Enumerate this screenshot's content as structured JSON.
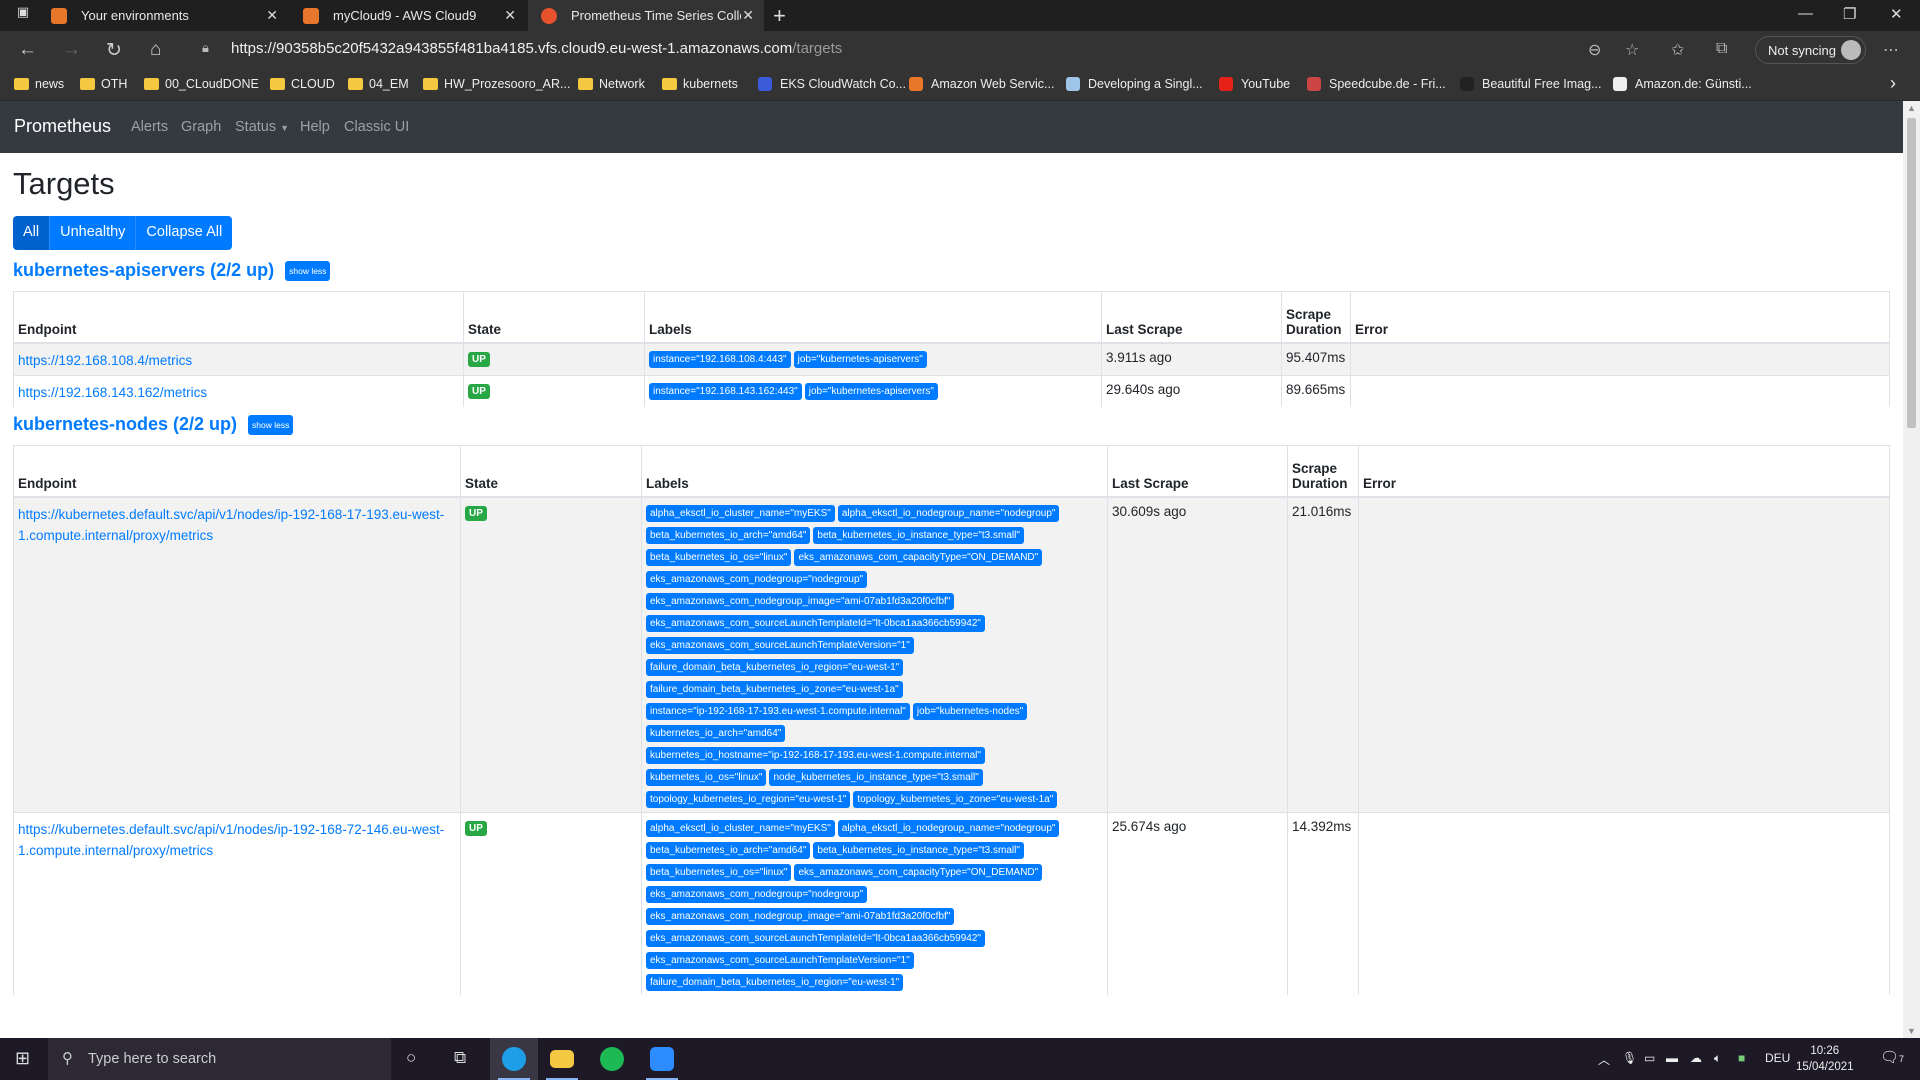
{
  "browser": {
    "tabs": [
      {
        "title": "Your environments",
        "color": "#e8762b"
      },
      {
        "title": "myCloud9 - AWS Cloud9",
        "color": "#e8762b"
      },
      {
        "title": "Prometheus Time Series Collecti",
        "color": "#e6522c"
      }
    ],
    "url_base": "https://90358b5c20f5432a943855f481ba4185.vfs.cloud9.eu-west-1.amazonaws.com",
    "url_path": "/targets",
    "sync_label": "Not syncing",
    "bookmarks": [
      {
        "label": "news",
        "kind": "folder"
      },
      {
        "label": "OTH",
        "kind": "folder"
      },
      {
        "label": "00_CLoudDONE",
        "kind": "folder"
      },
      {
        "label": "CLOUD",
        "kind": "folder"
      },
      {
        "label": "04_EM",
        "kind": "folder"
      },
      {
        "label": "HW_Prozesooro_AR...",
        "kind": "folder"
      },
      {
        "label": "Network",
        "kind": "folder"
      },
      {
        "label": "kubernets",
        "kind": "folder"
      },
      {
        "label": "EKS CloudWatch Co...",
        "kind": "site",
        "color": "#3b5bdb"
      },
      {
        "label": "Amazon Web Servic...",
        "kind": "site",
        "color": "#e8762b"
      },
      {
        "label": "Developing a Singl...",
        "kind": "site",
        "color": "#9ec5e8"
      },
      {
        "label": "YouTube",
        "kind": "site",
        "color": "#e62117"
      },
      {
        "label": "Speedcube.de - Fri...",
        "kind": "site",
        "color": "#c44"
      },
      {
        "label": "Beautiful Free Imag...",
        "kind": "site",
        "color": "#222"
      },
      {
        "label": "Amazon.de: Günsti...",
        "kind": "site",
        "color": "#eee"
      }
    ]
  },
  "nav": {
    "brand": "Prometheus",
    "links": [
      "Alerts",
      "Graph",
      "Status",
      "Help",
      "Classic UI"
    ]
  },
  "page": {
    "title": "Targets",
    "filters": [
      "All",
      "Unhealthy",
      "Collapse All"
    ],
    "show_less": "show less",
    "columns": [
      "Endpoint",
      "State",
      "Labels",
      "Last Scrape",
      "Scrape Duration",
      "Error"
    ]
  },
  "pools": [
    {
      "name": "kubernetes-apiservers (2/2 up)",
      "targets": [
        {
          "endpoint": "https://192.168.108.4/metrics",
          "state": "UP",
          "labels": [
            "instance=\"192.168.108.4:443\"",
            "job=\"kubernetes-apiservers\""
          ],
          "last_scrape": "3.911s ago",
          "duration": "95.407ms",
          "error": ""
        },
        {
          "endpoint": "https://192.168.143.162/metrics",
          "state": "UP",
          "labels": [
            "instance=\"192.168.143.162:443\"",
            "job=\"kubernetes-apiservers\""
          ],
          "last_scrape": "29.640s ago",
          "duration": "89.665ms",
          "error": ""
        }
      ]
    },
    {
      "name": "kubernetes-nodes (2/2 up)",
      "targets": [
        {
          "endpoint": "https://kubernetes.default.svc/api/v1/nodes/ip-192-168-17-193.eu-west-1.compute.internal/proxy/metrics",
          "state": "UP",
          "labels": [
            "alpha_eksctl_io_cluster_name=\"myEKS\"",
            "alpha_eksctl_io_nodegroup_name=\"nodegroup\"",
            "beta_kubernetes_io_arch=\"amd64\"",
            "beta_kubernetes_io_instance_type=\"t3.small\"",
            "beta_kubernetes_io_os=\"linux\"",
            "eks_amazonaws_com_capacityType=\"ON_DEMAND\"",
            "eks_amazonaws_com_nodegroup=\"nodegroup\"",
            "eks_amazonaws_com_nodegroup_image=\"ami-07ab1fd3a20f0cfbf\"",
            "eks_amazonaws_com_sourceLaunchTemplateId=\"lt-0bca1aa366cb59942\"",
            "eks_amazonaws_com_sourceLaunchTemplateVersion=\"1\"",
            "failure_domain_beta_kubernetes_io_region=\"eu-west-1\"",
            "failure_domain_beta_kubernetes_io_zone=\"eu-west-1a\"",
            "instance=\"ip-192-168-17-193.eu-west-1.compute.internal\"",
            "job=\"kubernetes-nodes\"",
            "kubernetes_io_arch=\"amd64\"",
            "kubernetes_io_hostname=\"ip-192-168-17-193.eu-west-1.compute.internal\"",
            "kubernetes_io_os=\"linux\"",
            "node_kubernetes_io_instance_type=\"t3.small\"",
            "topology_kubernetes_io_region=\"eu-west-1\"",
            "topology_kubernetes_io_zone=\"eu-west-1a\""
          ],
          "last_scrape": "30.609s ago",
          "duration": "21.016ms",
          "error": ""
        },
        {
          "endpoint": "https://kubernetes.default.svc/api/v1/nodes/ip-192-168-72-146.eu-west-1.compute.internal/proxy/metrics",
          "state": "UP",
          "labels": [
            "alpha_eksctl_io_cluster_name=\"myEKS\"",
            "alpha_eksctl_io_nodegroup_name=\"nodegroup\"",
            "beta_kubernetes_io_arch=\"amd64\"",
            "beta_kubernetes_io_instance_type=\"t3.small\"",
            "beta_kubernetes_io_os=\"linux\"",
            "eks_amazonaws_com_capacityType=\"ON_DEMAND\"",
            "eks_amazonaws_com_nodegroup=\"nodegroup\"",
            "eks_amazonaws_com_nodegroup_image=\"ami-07ab1fd3a20f0cfbf\"",
            "eks_amazonaws_com_sourceLaunchTemplateId=\"lt-0bca1aa366cb59942\"",
            "eks_amazonaws_com_sourceLaunchTemplateVersion=\"1\"",
            "failure_domain_beta_kubernetes_io_region=\"eu-west-1\""
          ],
          "last_scrape": "25.674s ago",
          "duration": "14.392ms",
          "error": ""
        }
      ]
    }
  ],
  "taskbar": {
    "search_placeholder": "Type here to search",
    "language": "DEU",
    "time": "10:26",
    "date": "15/04/2021",
    "notifications": "7"
  }
}
